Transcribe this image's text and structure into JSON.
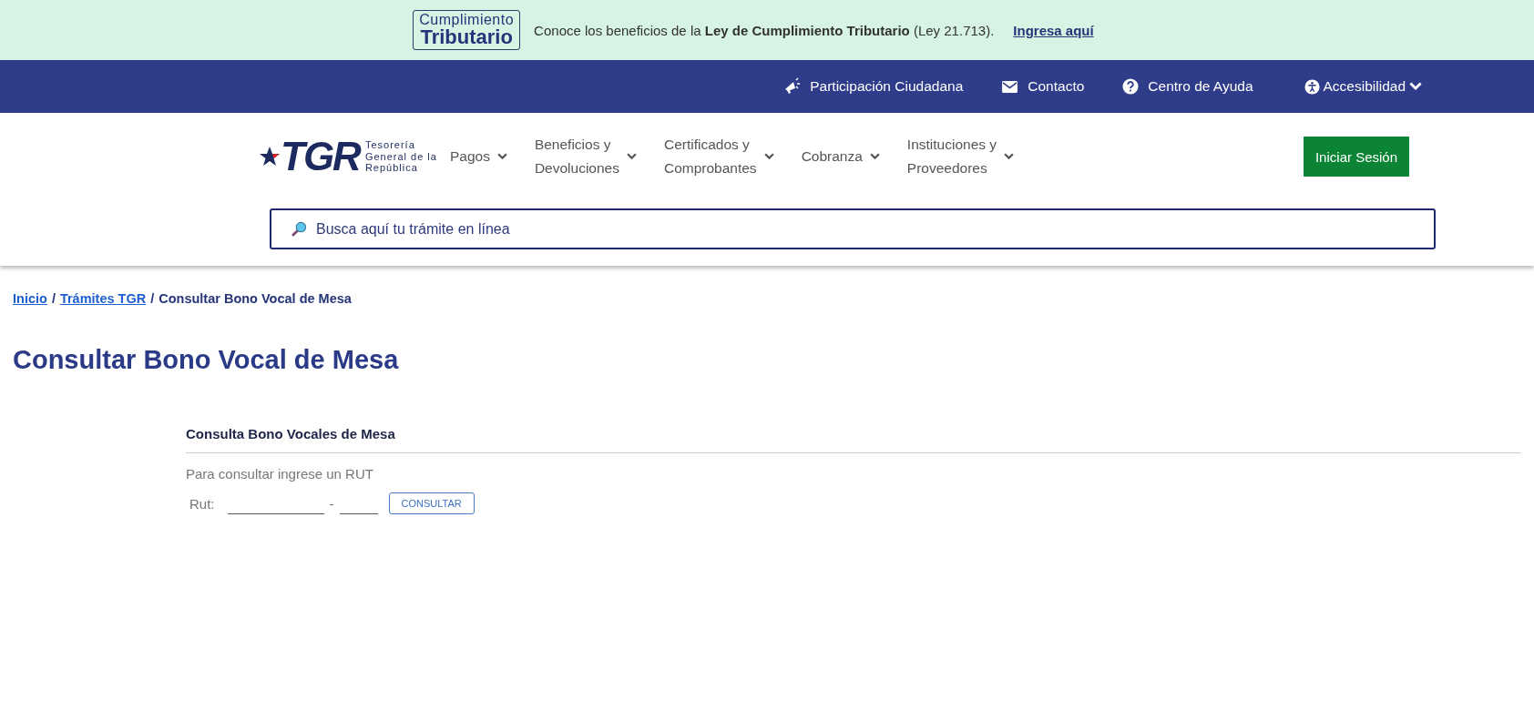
{
  "banner": {
    "badge_lines": [
      "Cumplimiento",
      "Tributario"
    ],
    "message": "Conoce los beneficios de la **Ley de Cumplimiento Tributario** (Ley 21.713).",
    "link": "Ingresa aquí"
  },
  "utility_links": [
    {
      "label": "Participación Ciudadana",
      "kind": "megaphone",
      "dropdown": false
    },
    {
      "label": "Contacto",
      "kind": "mail",
      "dropdown": false
    },
    {
      "label": "Centro de Ayuda",
      "kind": "help",
      "dropdown": false
    },
    {
      "label": "Accesibilidad",
      "kind": "accessibility",
      "dropdown": true
    }
  ],
  "logo": {
    "mark": "TGR",
    "lines": [
      "Tesorería",
      "General de la",
      "República"
    ]
  },
  "nav": [
    {
      "lines": [
        "Pagos"
      ]
    },
    {
      "lines": [
        "Beneficios y",
        "Devoluciones"
      ]
    },
    {
      "lines": [
        "Certificados y",
        "Comprobantes"
      ]
    },
    {
      "lines": [
        "Cobranza"
      ]
    },
    {
      "lines": [
        "Instituciones y",
        "Proveedores"
      ]
    }
  ],
  "login_button": "Iniciar Sesión",
  "search": {
    "placeholder": "Busca aquí tu trámite en línea"
  },
  "breadcrumb_separator": "/",
  "breadcrumb": [
    {
      "label": "Inicio",
      "link": true
    },
    {
      "label": "Trámites TGR",
      "link": true
    },
    {
      "label": "Consultar Bono Vocal de Mesa",
      "link": false
    }
  ],
  "title": "Consultar Bono Vocal de Mesa",
  "form": {
    "heading": "Consulta Bono Vocales de Mesa",
    "instruction": "Para consultar ingrese un RUT",
    "rut_label": "Rut:",
    "separator": "-",
    "button": "CONSULTAR"
  }
}
